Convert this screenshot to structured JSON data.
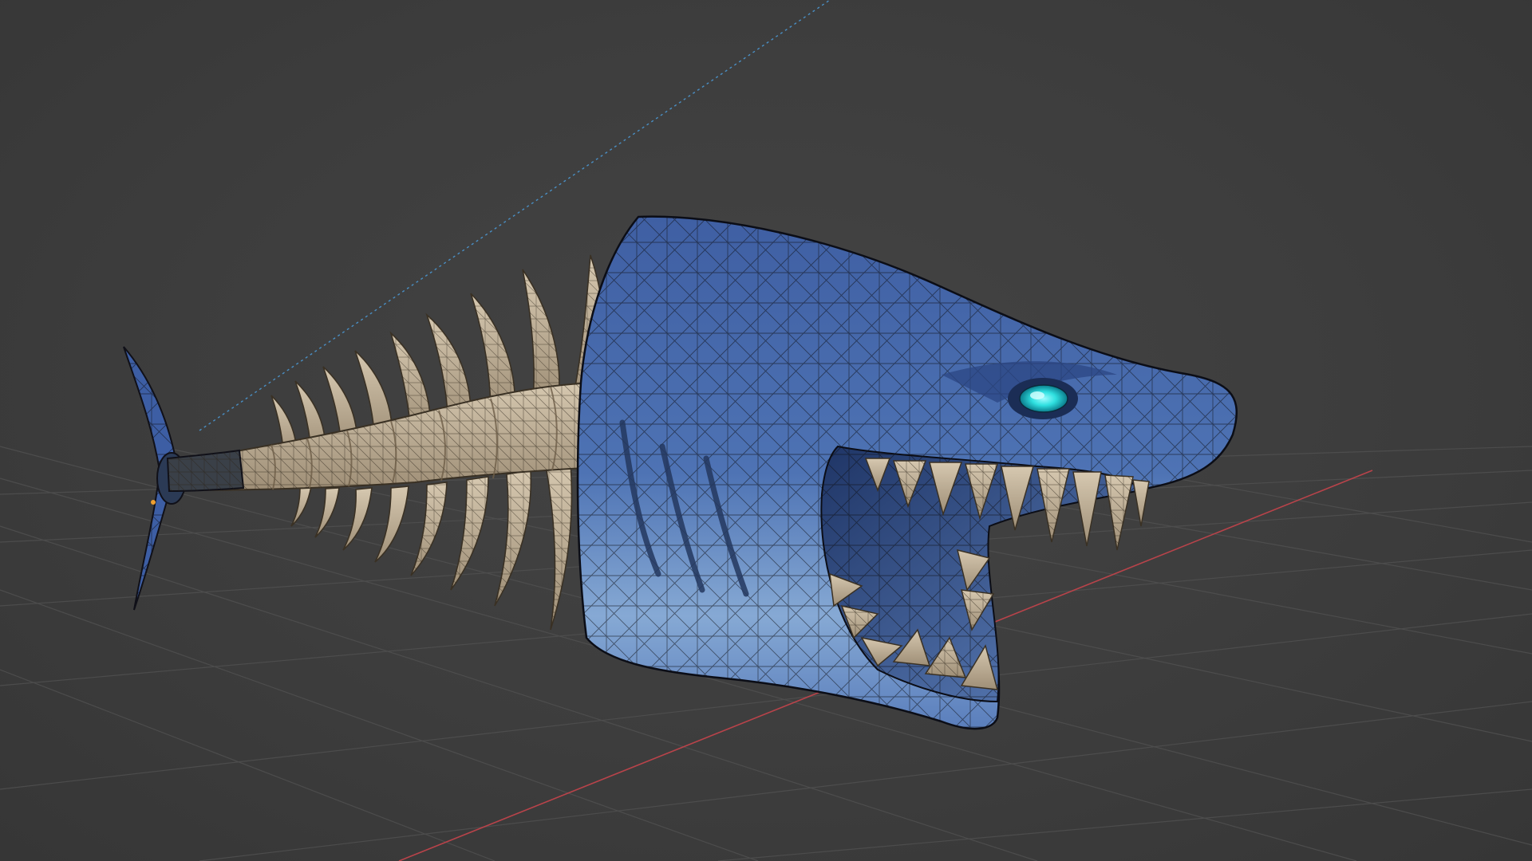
{
  "app": "3d-viewport",
  "view": {
    "mode": "perspective",
    "grid_floor": true,
    "axis_x_color": "#b8434a",
    "axis_y_dashed_color": "#4a8fc4",
    "background_color": "#3d3d3d",
    "grid_color": "#505050"
  },
  "scene": {
    "object": "skeletal-shark-head",
    "shading": "textured-with-wireframe",
    "skin_color": "#4a6fb0",
    "belly_color": "#8fb2d8",
    "bone_color": "#c4b49c",
    "eye_color": "#30e0e0",
    "wire_color": "#101018"
  }
}
